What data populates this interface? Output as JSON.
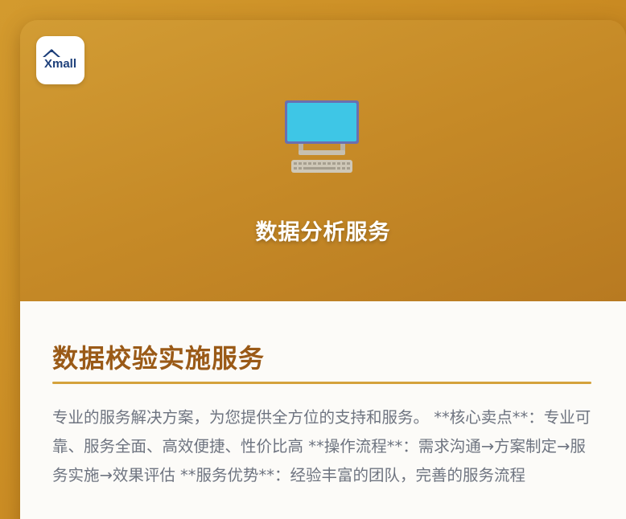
{
  "logo": {
    "text": "Xmall"
  },
  "hero": {
    "icon": "desktop-computer-icon",
    "title": "数据分析服务"
  },
  "section": {
    "title": "数据校验实施服务",
    "description": "专业的服务解决方案，为您提供全方位的支持和服务。 **核心卖点**：专业可靠、服务全面、高效便捷、性价比高 **操作流程**：需求沟通→方案制定→服务实施→效果评估 **服务优势**：经验丰富的团队，完善的服务流程"
  },
  "colors": {
    "background": "#c98a22",
    "title_brown": "#9a5a17",
    "divider_gold": "#d4a23c",
    "monitor_screen": "#3ec6e6",
    "monitor_frame": "#6a6fb0"
  }
}
